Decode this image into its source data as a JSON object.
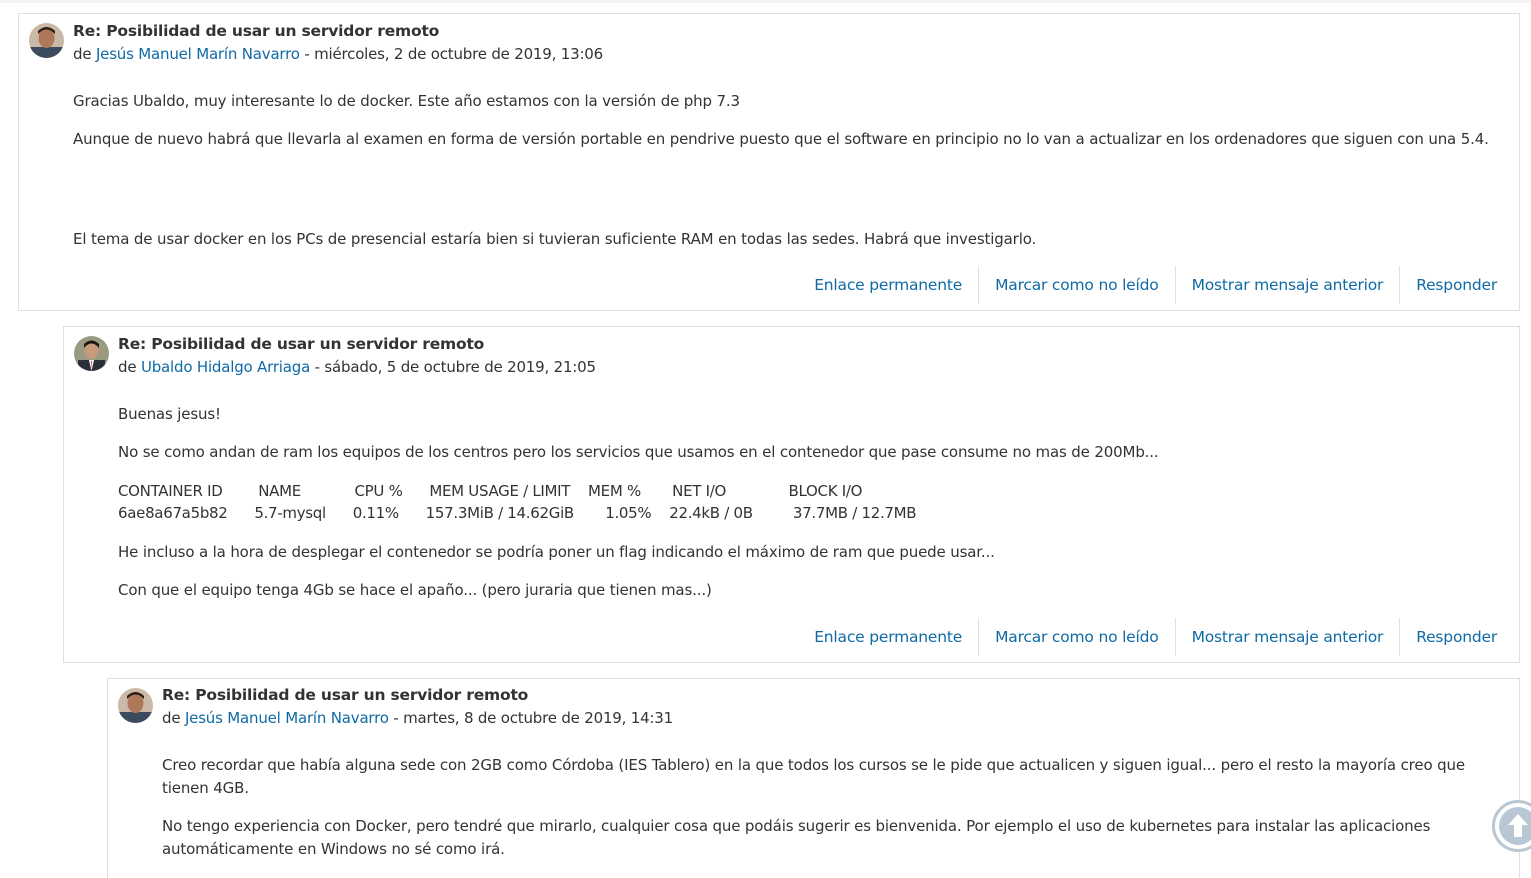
{
  "posts": [
    {
      "subject": "Re: Posibilidad de usar un servidor remoto",
      "by": "de",
      "author": "Jesús Manuel Marín Navarro",
      "date": "- miércoles, 2 de octubre de 2019, 13:06",
      "paragraphs": [
        "Gracias Ubaldo, muy interesante lo de docker. Este año estamos con la versión de php 7.3",
        "Aunque de nuevo habrá que llevarla al examen en forma de versión portable en pendrive puesto que el software en principio no lo van a actualizar en los ordenadores que siguen con una 5.4.",
        "El tema de usar docker en los PCs de presencial estaría bien si tuvieran suficiente RAM en todas las sedes. Habrá que investigarlo."
      ],
      "actions": [
        "Enlace permanente",
        "Marcar como no leído",
        "Mostrar mensaje anterior",
        "Responder"
      ]
    },
    {
      "subject": "Re: Posibilidad de usar un servidor remoto",
      "by": "de",
      "author": "Ubaldo Hidalgo Arriaga",
      "date": "- sábado, 5 de octubre de 2019, 21:05",
      "paragraphs": [
        "Buenas jesus!",
        "No se como andan de ram los equipos de los centros pero los servicios que usamos en el contenedor que pase consume no mas de 200Mb...",
        "He incluso a la hora de desplegar el contenedor se podría poner un flag indicando el máximo de ram que puede usar...",
        "Con que el equipo tenga 4Gb se hace el apaño... (pero juraria que tienen mas...)"
      ],
      "stats_header": "CONTAINER ID        NAME            CPU %      MEM USAGE / LIMIT    MEM %       NET I/O              BLOCK I/O",
      "stats_row": "6ae8a67a5b82      5.7-mysql      0.11%      157.3MiB / 14.62GiB       1.05%    22.4kB / 0B         37.7MB / 12.7MB",
      "actions": [
        "Enlace permanente",
        "Marcar como no leído",
        "Mostrar mensaje anterior",
        "Responder"
      ]
    },
    {
      "subject": "Re: Posibilidad de usar un servidor remoto",
      "by": "de",
      "author": "Jesús Manuel Marín Navarro",
      "date": "- martes, 8 de octubre de 2019, 14:31",
      "paragraphs": [
        "Creo recordar que había alguna sede con 2GB como Córdoba (IES Tablero) en la que todos los cursos se le pide que actualicen y siguen igual... pero el resto la mayoría creo que tienen 4GB.",
        "No tengo experiencia con Docker, pero tendré que mirarlo, cualquier cosa que podáis sugerir es bienvenida. Por ejemplo el uso de kubernetes para instalar las aplicaciones automáticamente en Windows no sé como irá."
      ]
    }
  ],
  "colors": {
    "link": "#0f6aa6",
    "text": "#333333",
    "border": "#dee2e6"
  },
  "icons": {
    "scroll_top": "arrow-up-circle-icon"
  }
}
